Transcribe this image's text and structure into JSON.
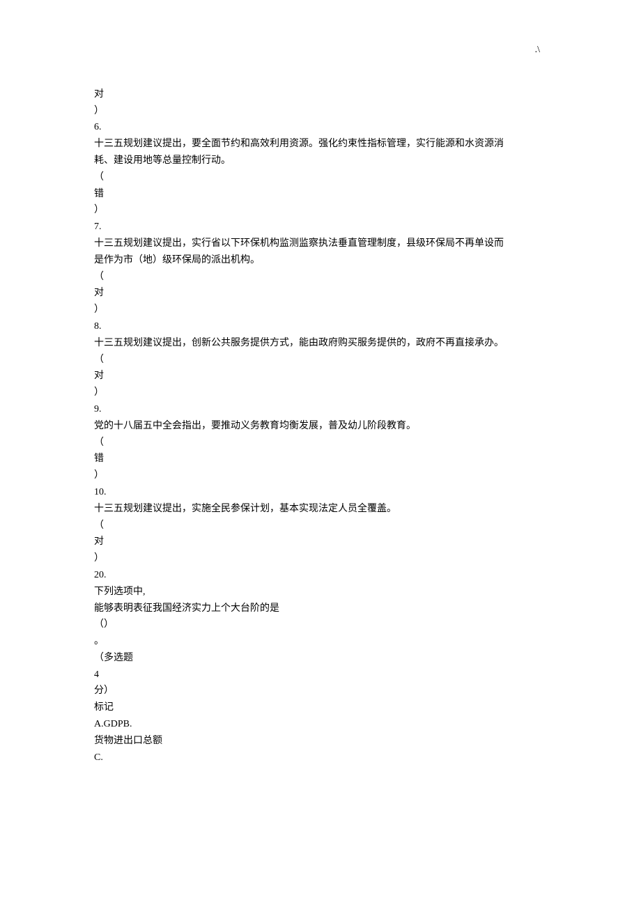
{
  "pageMarker": ".\\",
  "lines": [
    "对",
    "）",
    "6.",
    "十三五规划建议提出，要全面节约和高效利用资源。强化约束性指标管理，实行能源和水资源消",
    "耗、建设用地等总量控制行动。",
    "（",
    "错",
    "）",
    "7.",
    "十三五规划建议提出，实行省以下环保机构监测监察执法垂直管理制度，县级环保局不再单设而",
    "是作为市（地）级环保局的派出机构。",
    "（",
    "对",
    "）",
    "8.",
    "十三五规划建议提出，创新公共服务提供方式，能由政府购买服务提供的，政府不再直接承办。",
    "（",
    "对",
    "）",
    "9.",
    "党的十八届五中全会指出，要推动义务教育均衡发展，普及幼儿阶段教育。",
    "（",
    "错",
    "）",
    "10.",
    "十三五规划建议提出，实施全民参保计划，基本实现法定人员全覆盖。",
    "（",
    "对",
    "）",
    "20.",
    "下列选项中,",
    "能够表明表征我国经济实力上个大台阶的是",
    "（）",
    "。",
    "（多选题",
    "4",
    "分）",
    "标记",
    "A.GDPB.",
    "货物进出口总额",
    "C."
  ]
}
